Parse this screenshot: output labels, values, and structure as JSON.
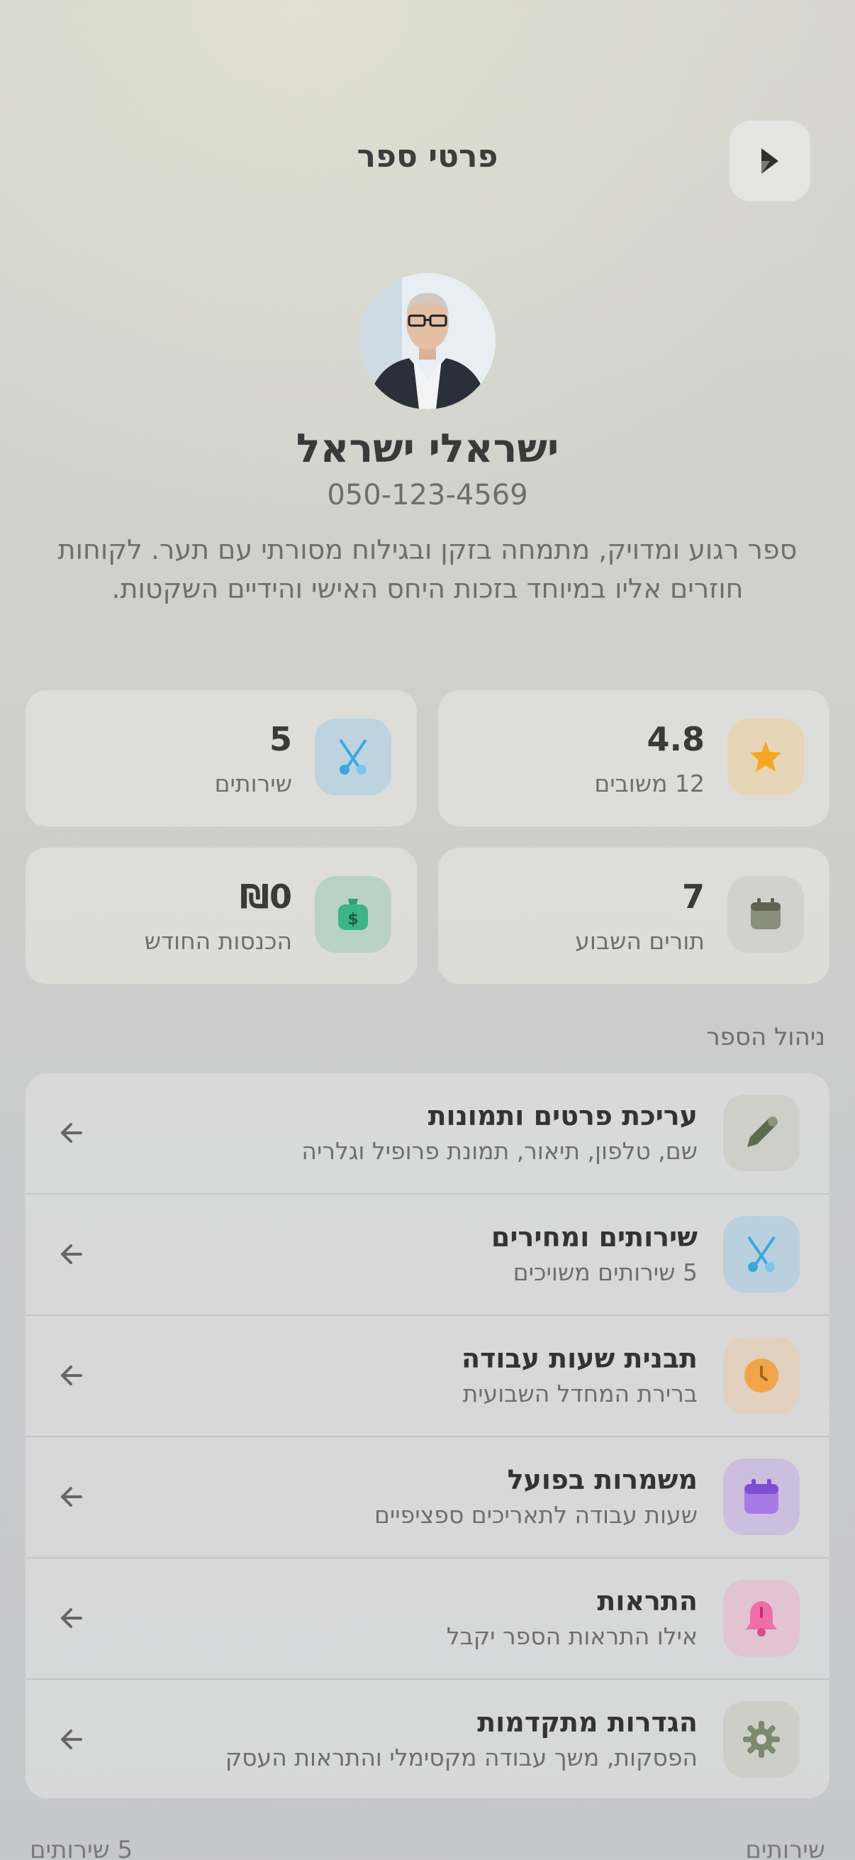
{
  "header": {
    "title": "פרטי ספר"
  },
  "profile": {
    "name": "ישראלי ישראל",
    "phone": "050-123-4569",
    "bio": "ספר רגוע ומדויק, מתמחה בזקן ובגילוח מסורתי עם תער. לקוחות חוזרים אליו במיוחד בזכות היחס האישי והידיים השקטות."
  },
  "stats": [
    {
      "value": "4.8",
      "label": "12 משובים",
      "icon": "star-icon",
      "color": "#f5a623"
    },
    {
      "value": "5",
      "label": "שירותים",
      "icon": "scissors-icon",
      "color": "#3aa7e0"
    },
    {
      "value": "7",
      "label": "תורים השבוע",
      "icon": "calendar-icon",
      "color": "#6b6f5c"
    },
    {
      "value": "₪0",
      "label": "הכנסות החודש",
      "icon": "money-bag-icon",
      "color": "#2ea37a"
    }
  ],
  "management": {
    "title": "ניהול הספר",
    "items": [
      {
        "title": "עריכת פרטים ותמונות",
        "subtitle": "שם, טלפון, תיאור, תמונת פרופיל וגלריה",
        "icon": "pencil-icon"
      },
      {
        "title": "שירותים ומחירים",
        "subtitle": "5 שירותים משויכים",
        "icon": "scissors-icon"
      },
      {
        "title": "תבנית שעות עבודה",
        "subtitle": "ברירת המחדל השבועית",
        "icon": "clock-icon"
      },
      {
        "title": "משמרות בפועל",
        "subtitle": "שעות עבודה לתאריכים ספציפיים",
        "icon": "calendar-icon"
      },
      {
        "title": "התראות",
        "subtitle": "אילו התראות הספר יקבל",
        "icon": "bell-icon"
      },
      {
        "title": "הגדרות מתקדמות",
        "subtitle": "הפסקות, משך עבודה מקסימלי והתראות העסק",
        "icon": "gear-icon"
      }
    ]
  },
  "footer": {
    "right": "שירותים",
    "left": "5 שירותים"
  }
}
